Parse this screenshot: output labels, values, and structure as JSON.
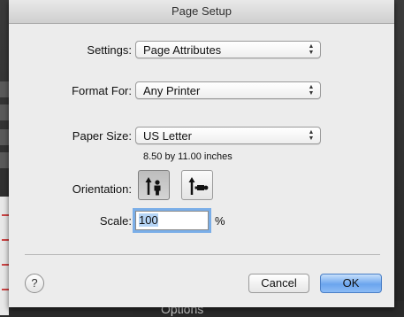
{
  "dialog": {
    "title": "Page Setup",
    "settings_label": "Settings:",
    "settings_value": "Page Attributes",
    "format_label": "Format For:",
    "format_value": "Any Printer",
    "paper_label": "Paper Size:",
    "paper_value": "US Letter",
    "paper_dimensions": "8.50 by 11.00 inches",
    "orientation_label": "Orientation:",
    "orientation_selected": "portrait",
    "scale_label": "Scale:",
    "scale_value": "100",
    "scale_unit": "%",
    "help_symbol": "?",
    "cancel_label": "Cancel",
    "ok_label": "OK"
  },
  "background": {
    "partial_text": "Options"
  },
  "colors": {
    "default_button": "#6ba5ee",
    "focus_ring": "#7aaee8"
  }
}
